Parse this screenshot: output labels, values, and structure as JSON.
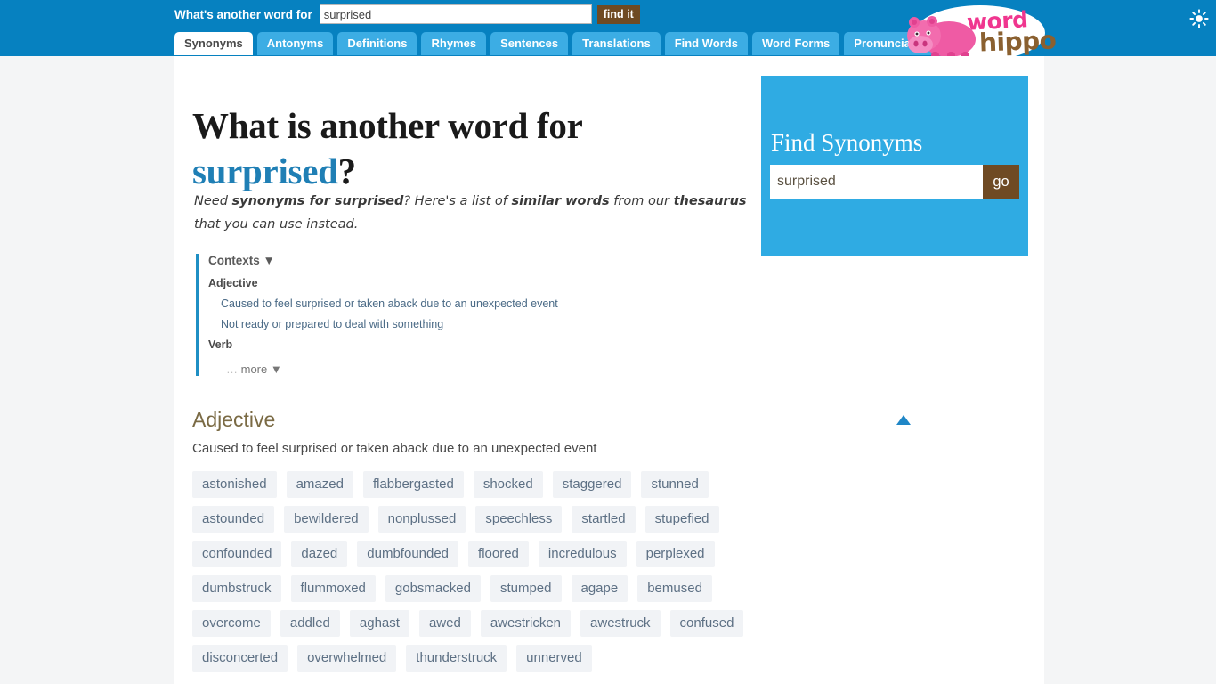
{
  "header": {
    "search_label": "What's another word for",
    "search_value": "surprised",
    "search_placeholder": "",
    "find_button": "find it",
    "tabs": [
      {
        "label": "Synonyms",
        "active": true
      },
      {
        "label": "Antonyms",
        "active": false
      },
      {
        "label": "Definitions",
        "active": false
      },
      {
        "label": "Rhymes",
        "active": false
      },
      {
        "label": "Sentences",
        "active": false
      },
      {
        "label": "Translations",
        "active": false
      },
      {
        "label": "Find Words",
        "active": false
      },
      {
        "label": "Word Forms",
        "active": false
      },
      {
        "label": "Pronunciations",
        "active": false
      }
    ],
    "logo": {
      "word_part": "word",
      "hippo_part": "hippo",
      "word_color": "#f0368f",
      "hippo_color": "#8a6030",
      "hippo_body_color": "#ef5ba4"
    },
    "theme_toggle_icon": "sun-icon",
    "bar_color": "#0681c0",
    "tab_color": "#3cade4",
    "find_button_color": "#6f4a23"
  },
  "main": {
    "heading_prefix": "What is another word for",
    "heading_keyword": "surprised",
    "heading_suffix": "?",
    "heading_keyword_color": "#1f7fb5",
    "speaker_icon": "speaker-icon",
    "lede": {
      "t1": "Need ",
      "b1": "synonyms for surprised",
      "t2": "? Here's a list of ",
      "b2": "similar words",
      "t3": " from our ",
      "b3": "thesaurus",
      "t4": " that you can use instead."
    },
    "contexts": {
      "title": "Contexts",
      "caret": "▼",
      "groups": [
        {
          "pos": "Adjective",
          "definitions": [
            "Caused to feel surprised or taken aback due to an unexpected event",
            "Not ready or prepared to deal with something"
          ]
        },
        {
          "pos": "Verb",
          "definitions": []
        }
      ],
      "more_dots": "…",
      "more_label": "more",
      "more_caret": "▼",
      "accent_color": "#1f8fc4"
    },
    "section": {
      "title": "Adjective",
      "title_color": "#7a6a44",
      "definition": "Caused to feel surprised or taken aback due to an unexpected event",
      "collapse_icon": "collapse-triangle-up-icon",
      "collapse_color": "#1f86c6",
      "chip_bg": "#f1f3f6",
      "chip_color": "#5d7084",
      "words": [
        "astonished",
        "amazed",
        "flabbergasted",
        "shocked",
        "staggered",
        "stunned",
        "astounded",
        "bewildered",
        "nonplussed",
        "speechless",
        "startled",
        "stupefied",
        "confounded",
        "dazed",
        "dumbfounded",
        "floored",
        "incredulous",
        "perplexed",
        "dumbstruck",
        "flummoxed",
        "gobsmacked",
        "stumped",
        "agape",
        "bemused",
        "overcome",
        "addled",
        "aghast",
        "awed",
        "awestricken",
        "awestruck",
        "confused",
        "disconcerted",
        "overwhelmed",
        "thunderstruck",
        "unnerved"
      ]
    }
  },
  "sidebar": {
    "title": "Find Synonyms",
    "input_value": "surprised",
    "input_placeholder": "",
    "go_button": "go",
    "box_color": "#2fabe3",
    "go_color": "#6f4a23"
  }
}
